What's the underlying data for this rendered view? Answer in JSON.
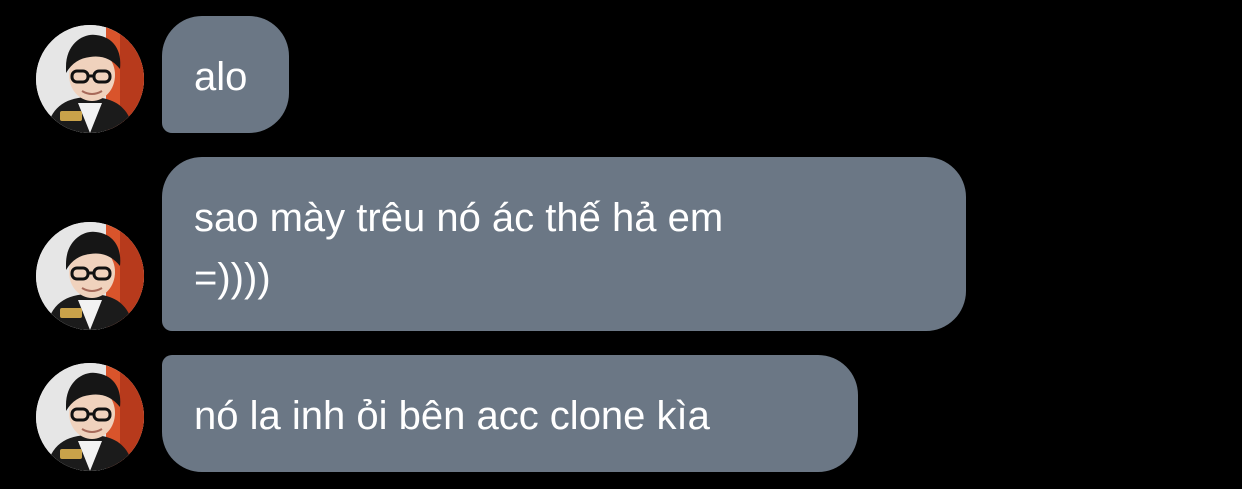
{
  "messages": [
    {
      "lines": [
        "alo"
      ]
    },
    {
      "lines": [
        "sao mày trêu nó ác thế hả em",
        "=))))"
      ]
    },
    {
      "lines": [
        "nó la inh ỏi bên acc clone kìa"
      ]
    }
  ],
  "colors": {
    "background": "#000000",
    "bubble": "#6b7785",
    "text": "#ffffff"
  },
  "icons": [
    "avatar-photo"
  ]
}
